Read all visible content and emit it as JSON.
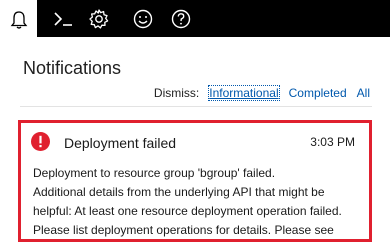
{
  "toolbar": {
    "buttons": [
      {
        "icon": "bell-icon",
        "active": true
      },
      {
        "icon": "cloud-shell-icon",
        "active": false
      },
      {
        "icon": "gear-icon",
        "active": false
      },
      {
        "icon": "smiley-icon",
        "active": false
      },
      {
        "icon": "help-icon",
        "active": false
      }
    ]
  },
  "page": {
    "title": "Notifications"
  },
  "dismiss": {
    "label": "Dismiss:",
    "options": [
      "Informational",
      "Completed",
      "All"
    ],
    "selected": "Informational"
  },
  "notification": {
    "status": "error",
    "title": "Deployment failed",
    "time": "3:03 PM",
    "body_lines": [
      "Deployment to resource group 'bgroup' failed.",
      "Additional details from the underlying API that might be",
      "helpful: At least one resource deployment operation failed.",
      "Please list deployment operations for details. Please see"
    ]
  },
  "colors": {
    "error": "#e0202f",
    "link": "#0058ad",
    "topbar": "#000000"
  }
}
